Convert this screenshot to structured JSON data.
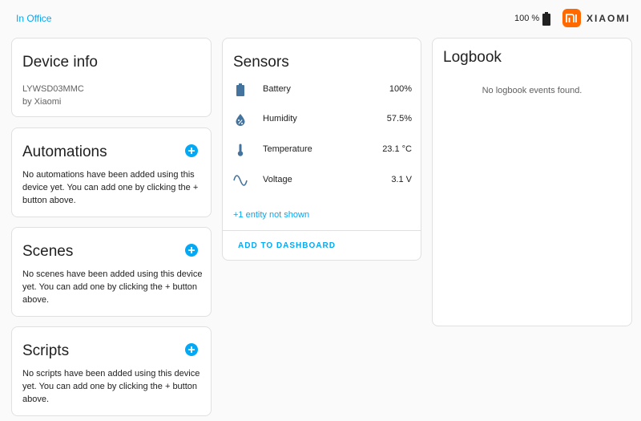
{
  "header": {
    "area_label": "In Office",
    "battery_text": "100 %",
    "brand_name": "XIAOMI",
    "brand_color": "#ff6900"
  },
  "device_info": {
    "title": "Device info",
    "model": "LYWSD03MMC",
    "manufacturer": "by Xiaomi"
  },
  "automations": {
    "title": "Automations",
    "empty_lines": [
      "No automations have been added using this",
      "device yet. You can add one by clicking the +",
      "button above."
    ]
  },
  "scenes": {
    "title": "Scenes",
    "empty_lines": [
      "No scenes have been added using this device",
      "yet. You can add one by clicking the + button",
      "above."
    ]
  },
  "scripts": {
    "title": "Scripts",
    "empty_lines": [
      "No scripts have been added using this device",
      "yet. You can add one by clicking the + button",
      "above."
    ]
  },
  "sensors": {
    "title": "Sensors",
    "items": [
      {
        "icon": "battery-icon",
        "name": "Battery",
        "value": "100%"
      },
      {
        "icon": "water-percent-icon",
        "name": "Humidity",
        "value": "57.5%"
      },
      {
        "icon": "thermometer-icon",
        "name": "Temperature",
        "value": "23.1 °C"
      },
      {
        "icon": "sine-wave-icon",
        "name": "Voltage",
        "value": "3.1 V"
      }
    ],
    "hidden_entities_link": "+1 entity not shown",
    "add_button": "ADD TO DASHBOARD"
  },
  "logbook": {
    "title": "Logbook",
    "empty_message": "No logbook events found."
  },
  "colors": {
    "accent": "#03a9f4",
    "icon": "#44739e"
  }
}
